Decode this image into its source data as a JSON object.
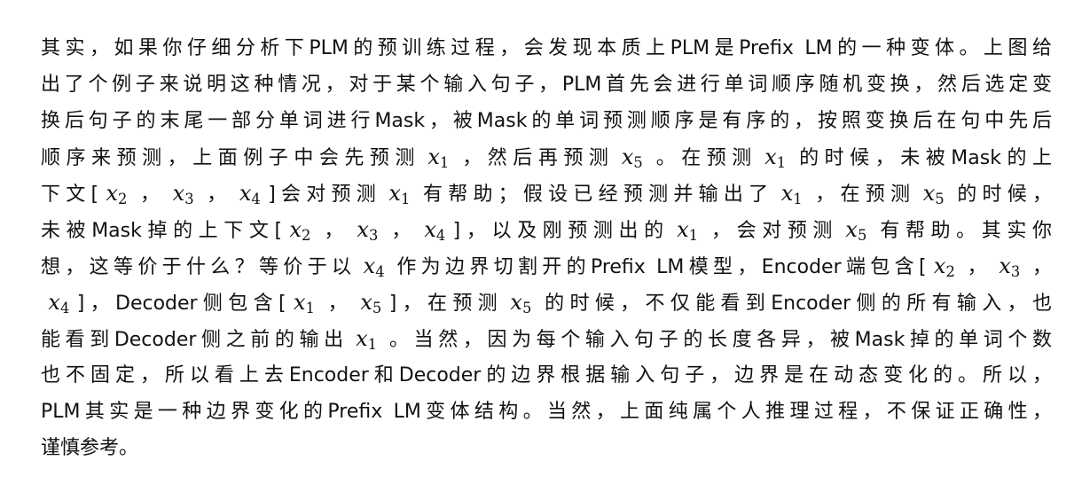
{
  "paragraph": {
    "lines": [
      {
        "segments": [
          {
            "t": "其实，如果你仔细分析下PLM的预训练过程，会发现本质上PLM是Prefix LM的一种变体。上图给"
          }
        ]
      },
      {
        "segments": [
          {
            "t": "出了个例子来说明这种情况，对于某个输入句子，PLM首先会进行单词顺序随机变换，然后选定变"
          }
        ]
      },
      {
        "segments": [
          {
            "t": "换后句子的末尾一部分单词进行Mask，被Mask的单词预测顺序是有序的，按照变换后在句中先后"
          }
        ]
      },
      {
        "segments": [
          {
            "t": "顺序来预测，上面例子中会先预测"
          },
          {
            "v": "x",
            "s": "1"
          },
          {
            "t": "，然后再预测"
          },
          {
            "v": "x",
            "s": "5"
          },
          {
            "t": "。在预测"
          },
          {
            "v": "x",
            "s": "1"
          },
          {
            "t": "的时候，未被Mask的上"
          }
        ]
      },
      {
        "segments": [
          {
            "t": "下文["
          },
          {
            "v": "x",
            "s": "2"
          },
          {
            "t": "，"
          },
          {
            "v": "x",
            "s": "3"
          },
          {
            "t": "，"
          },
          {
            "v": "x",
            "s": "4"
          },
          {
            "t": "]会对预测"
          },
          {
            "v": "x",
            "s": "1"
          },
          {
            "t": "有帮助；假设已经预测并输出了"
          },
          {
            "v": "x",
            "s": "1"
          },
          {
            "t": "，在预测"
          },
          {
            "v": "x",
            "s": "5"
          },
          {
            "t": "的时候，"
          }
        ]
      },
      {
        "segments": [
          {
            "t": "未被Mask掉的上下文["
          },
          {
            "v": "x",
            "s": "2"
          },
          {
            "t": "，"
          },
          {
            "v": "x",
            "s": "3"
          },
          {
            "t": "，"
          },
          {
            "v": "x",
            "s": "4"
          },
          {
            "t": "]，以及刚预测出的"
          },
          {
            "v": "x",
            "s": "1"
          },
          {
            "t": "，会对预测"
          },
          {
            "v": "x",
            "s": "5"
          },
          {
            "t": "有帮助。其实你"
          }
        ]
      },
      {
        "segments": [
          {
            "t": "想，这等价于什么？等价于以"
          },
          {
            "v": "x",
            "s": "4"
          },
          {
            "t": "作为边界切割开的Prefix LM模型，Encoder端包含["
          },
          {
            "v": "x",
            "s": "2"
          },
          {
            "t": "，"
          },
          {
            "v": "x",
            "s": "3"
          },
          {
            "t": "，"
          }
        ]
      },
      {
        "segments": [
          {
            "v": "x",
            "s": "4"
          },
          {
            "t": "]，Decoder侧包含["
          },
          {
            "v": "x",
            "s": "1"
          },
          {
            "t": "，"
          },
          {
            "v": "x",
            "s": "5"
          },
          {
            "t": "]，在预测"
          },
          {
            "v": "x",
            "s": "5"
          },
          {
            "t": "的时候，不仅能看到Encoder侧的所有输入，也"
          }
        ]
      },
      {
        "segments": [
          {
            "t": "能看到Decoder侧之前的输出"
          },
          {
            "v": "x",
            "s": "1"
          },
          {
            "t": "。当然，因为每个输入句子的长度各异，被Mask掉的单词个数"
          }
        ]
      },
      {
        "segments": [
          {
            "t": "也不固定，所以看上去Encoder和Decoder的边界根据输入句子，边界是在动态变化的。所以，"
          }
        ]
      },
      {
        "segments": [
          {
            "t": "PLM其实是一种边界变化的Prefix LM变体结构。当然，上面纯属个人推理过程，不保证正确性，"
          }
        ]
      },
      {
        "segments": [
          {
            "t": "谨慎参考。"
          }
        ]
      }
    ]
  }
}
